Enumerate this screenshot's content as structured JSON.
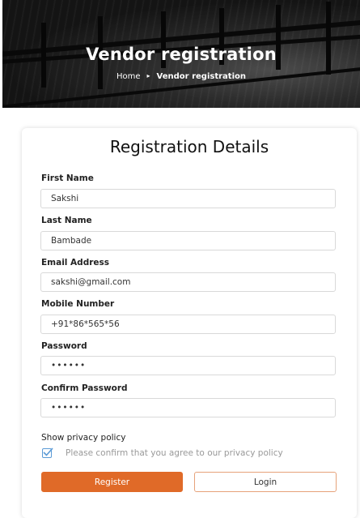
{
  "hero": {
    "title": "Vendor registration",
    "breadcrumb": {
      "home": "Home",
      "separator": "▸",
      "current": "Vendor registration"
    }
  },
  "form": {
    "title": "Registration Details",
    "fields": [
      {
        "label": "First Name",
        "value": "Sakshi"
      },
      {
        "label": "Last Name",
        "value": "Bambade"
      },
      {
        "label": "Email Address",
        "value": "sakshi@gmail.com"
      },
      {
        "label": "Mobile Number",
        "value": "+91*86*565*56"
      },
      {
        "label": "Password",
        "value": "••••••"
      },
      {
        "label": "Confirm Password",
        "value": "••••••"
      }
    ],
    "privacy_label": "Show privacy policy",
    "privacy_checkbox_text": "Please confirm that you agree to our privacy policy",
    "privacy_checked": true,
    "register_label": "Register",
    "login_label": "Login"
  },
  "colors": {
    "accent": "#e06a28",
    "checkbox": "#5a9ad6"
  }
}
